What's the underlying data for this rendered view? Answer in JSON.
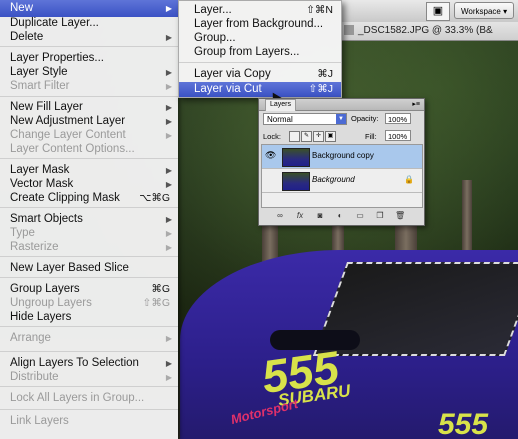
{
  "topbar": {
    "workspace_icon": "screen-mode-icon",
    "workspace_label": "Workspace ▾"
  },
  "document": {
    "title": "_DSC1582.JPG @ 33.3% (B&"
  },
  "menu": {
    "items": [
      {
        "label": "New",
        "shortcut": "",
        "submenu": true,
        "disabled": false,
        "selected": true
      },
      {
        "label": "Duplicate Layer...",
        "shortcut": "",
        "submenu": false,
        "disabled": false
      },
      {
        "label": "Delete",
        "shortcut": "",
        "submenu": true,
        "disabled": false
      },
      {
        "label": "Layer Properties...",
        "shortcut": "",
        "submenu": false,
        "disabled": false
      },
      {
        "label": "Layer Style",
        "shortcut": "",
        "submenu": true,
        "disabled": false
      },
      {
        "label": "Smart Filter",
        "shortcut": "",
        "submenu": true,
        "disabled": true
      },
      {
        "label": "New Fill Layer",
        "shortcut": "",
        "submenu": true,
        "disabled": false
      },
      {
        "label": "New Adjustment Layer",
        "shortcut": "",
        "submenu": true,
        "disabled": false
      },
      {
        "label": "Change Layer Content",
        "shortcut": "",
        "submenu": true,
        "disabled": true
      },
      {
        "label": "Layer Content Options...",
        "shortcut": "",
        "submenu": false,
        "disabled": true
      },
      {
        "label": "Layer Mask",
        "shortcut": "",
        "submenu": true,
        "disabled": false
      },
      {
        "label": "Vector Mask",
        "shortcut": "",
        "submenu": true,
        "disabled": false
      },
      {
        "label": "Create Clipping Mask",
        "shortcut": "⌥⌘G",
        "submenu": false,
        "disabled": false
      },
      {
        "label": "Smart Objects",
        "shortcut": "",
        "submenu": true,
        "disabled": false
      },
      {
        "label": "Type",
        "shortcut": "",
        "submenu": true,
        "disabled": true
      },
      {
        "label": "Rasterize",
        "shortcut": "",
        "submenu": true,
        "disabled": true
      },
      {
        "label": "New Layer Based Slice",
        "shortcut": "",
        "submenu": false,
        "disabled": false
      },
      {
        "label": "Group Layers",
        "shortcut": "⌘G",
        "submenu": false,
        "disabled": false
      },
      {
        "label": "Ungroup Layers",
        "shortcut": "⇧⌘G",
        "submenu": false,
        "disabled": true
      },
      {
        "label": "Hide Layers",
        "shortcut": "",
        "submenu": false,
        "disabled": false
      },
      {
        "label": "Arrange",
        "shortcut": "",
        "submenu": true,
        "disabled": true
      },
      {
        "label": "Align Layers To Selection",
        "shortcut": "",
        "submenu": true,
        "disabled": false
      },
      {
        "label": "Distribute",
        "shortcut": "",
        "submenu": true,
        "disabled": true
      },
      {
        "label": "Lock All Layers in Group...",
        "shortcut": "",
        "submenu": false,
        "disabled": true
      },
      {
        "label": "Link Layers",
        "shortcut": "",
        "submenu": false,
        "disabled": true
      }
    ]
  },
  "submenu": {
    "items": [
      {
        "label": "Layer...",
        "shortcut": "⇧⌘N"
      },
      {
        "label": "Layer from Background...",
        "shortcut": ""
      },
      {
        "label": "Group...",
        "shortcut": ""
      },
      {
        "label": "Group from Layers...",
        "shortcut": ""
      },
      {
        "label": "Layer via Copy",
        "shortcut": "⌘J"
      },
      {
        "label": "Layer via Cut",
        "shortcut": "⇧⌘J",
        "selected": true
      }
    ]
  },
  "layers_panel": {
    "tab_label": "Layers",
    "blend_mode": "Normal",
    "opacity_label": "Opacity:",
    "opacity_value": "100%",
    "lock_label": "Lock:",
    "fill_label": "Fill:",
    "fill_value": "100%",
    "layers": [
      {
        "name": "Background copy",
        "visible": true,
        "selected": true,
        "locked": false
      },
      {
        "name": "Background",
        "visible": false,
        "selected": false,
        "locked": true
      }
    ],
    "bottom_icons": [
      "link-icon",
      "fx-icon",
      "mask-icon",
      "adjustment-icon",
      "group-icon",
      "new-layer-icon",
      "trash-icon"
    ]
  },
  "photo": {
    "car_number": "555",
    "car_brand": "SUBARU",
    "car_sponsor": "Motorsport",
    "colors": {
      "car": "#2c1f8a",
      "yellow": "#d8e24a"
    }
  },
  "colors": {
    "menu_bg": "#f3f3f3",
    "highlight": "#3b52c4",
    "disabled_text": "#9a9a9a"
  }
}
